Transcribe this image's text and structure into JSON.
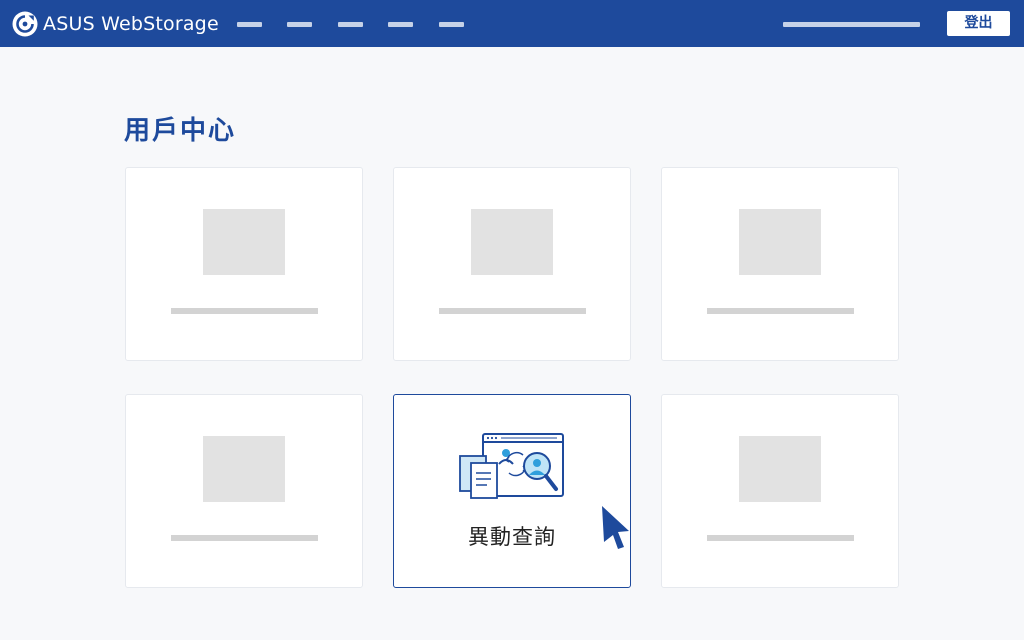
{
  "header": {
    "brand": "ASUS WebStorage",
    "logout_label": "登出"
  },
  "main": {
    "title": "用戶中心",
    "cards": [
      {
        "label": ""
      },
      {
        "label": ""
      },
      {
        "label": ""
      },
      {
        "label": ""
      },
      {
        "label": "異動查詢",
        "icon": "activity-search-icon"
      },
      {
        "label": ""
      }
    ]
  },
  "colors": {
    "header_bg": "#1e4a9c",
    "accent": "#1e4a9c",
    "page_bg": "#f7f8fa",
    "illustration_accent": "#2f9fdc"
  }
}
